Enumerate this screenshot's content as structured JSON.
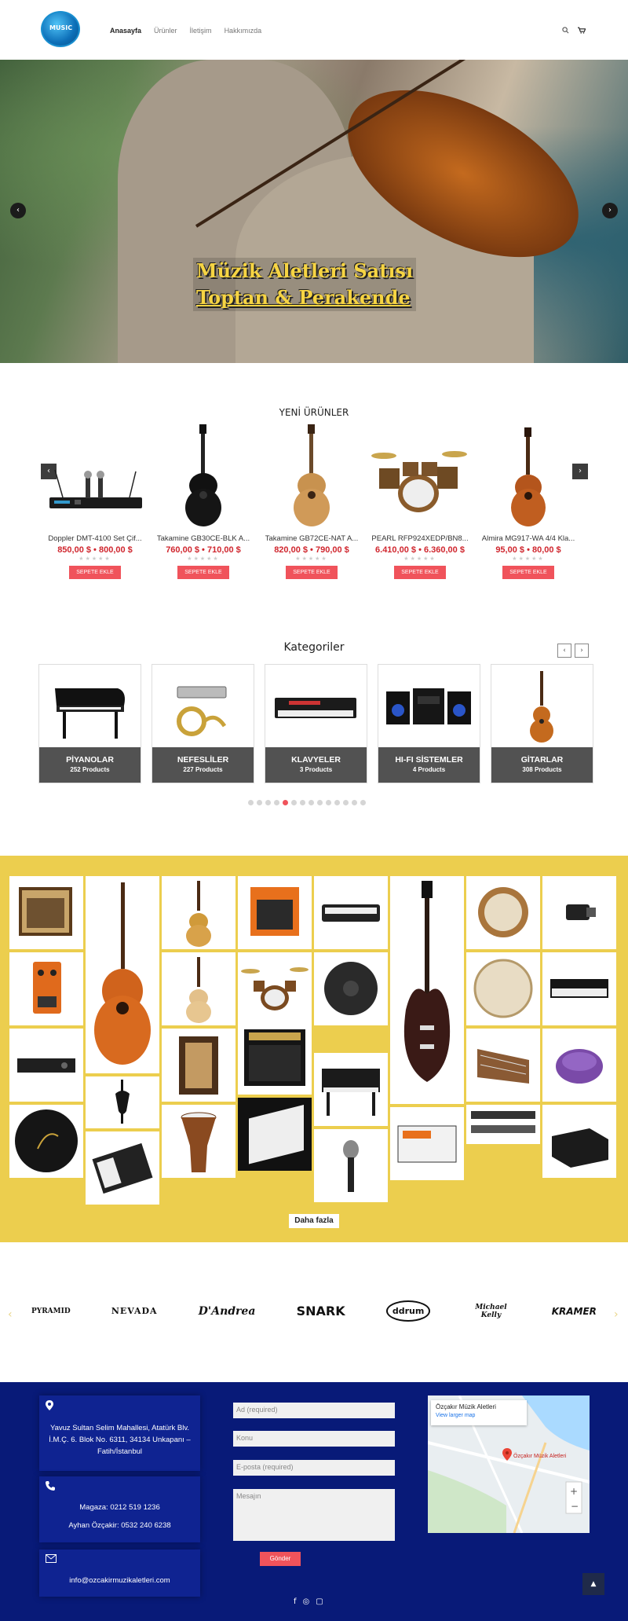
{
  "header": {
    "logo_text": "MUSIC",
    "nav": [
      "Anasayfa",
      "Ürünler",
      "İletişim",
      "Hakkımızda"
    ],
    "search_icon": "search-icon",
    "cart_icon": "cart-icon"
  },
  "hero": {
    "title_line1": "Müzik Aletleri Satısı",
    "title_line2": "Toptan & Perakende",
    "prev": "‹",
    "next": "›"
  },
  "new_products": {
    "title": "YENİ ÜRÜNLER",
    "cart_label": "SEPETE EKLE",
    "items": [
      {
        "name": "Doppler DMT-4100 Set Çif...",
        "price": "850,00 $ • 800,00 $"
      },
      {
        "name": "Takamine GB30CE-BLK A...",
        "price": "760,00 $ • 710,00 $"
      },
      {
        "name": "Takamine GB72CE-NAT A...",
        "price": "820,00 $ • 790,00 $"
      },
      {
        "name": "PEARL RFP924XEDP/BN8...",
        "price": "6.410,00 $ • 6.360,00 $"
      },
      {
        "name": "Almira MG917-WA 4/4 Kla...",
        "price": "95,00 $ • 80,00 $"
      }
    ]
  },
  "categories": {
    "title": "Kategoriler",
    "items": [
      {
        "name": "PİYANOLAR",
        "count": "252 Products"
      },
      {
        "name": "NEFESLİLER",
        "count": "227 Products"
      },
      {
        "name": "KLAVYELER",
        "count": "3 Products"
      },
      {
        "name": "HI-FI SİSTEMLER",
        "count": "4 Products"
      },
      {
        "name": "GİTARLAR",
        "count": "308 Products"
      }
    ]
  },
  "gallery": {
    "more_label": "Daha fazla"
  },
  "brands": [
    "PYRAMID",
    "NEVADA",
    "D'Andrea",
    "SNARK",
    "ddrum",
    "Michael Kelly",
    "KRAMER"
  ],
  "footer": {
    "address": "Yavuz Sultan Selim Mahallesi, Atatürk Blv. İ.M.Ç. 6. Blok No. 6311, 34134 Unkapanı – Fatih/İstanbul",
    "phone1": "Magaza: 0212 519 1236",
    "phone2": "Ayhan Özçakir: 0532 240 6238",
    "email": "info@ozcakirmuzikaletleri.com",
    "form": {
      "name_placeholder": "Ad (required)",
      "subject_placeholder": "Konu",
      "email_placeholder": "E-posta (required)",
      "message_placeholder": "Mesajın",
      "send_label": "Gönder"
    },
    "map": {
      "title": "Özçakır Müzik Aletleri",
      "link": "View larger map",
      "pin_label": "Özçakır Müzik Aletleri"
    }
  },
  "colors": {
    "accent_red": "#f0535b",
    "price_red": "#d0262e",
    "gallery_yellow": "#ecce4e",
    "footer_blue": "#081a78",
    "hero_gold": "#f6d443"
  }
}
